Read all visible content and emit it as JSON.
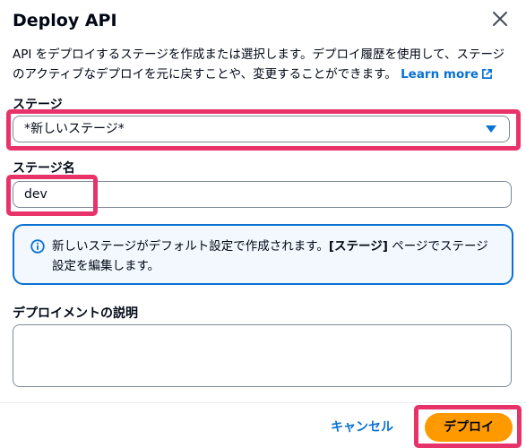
{
  "dialog": {
    "title": "Deploy API",
    "description": "API をデプロイするステージを作成または選択します。デプロイ履歴を使用して、ステージのアクティブなデプロイを元に戻すことや、変更することができます。",
    "learn_more": "Learn more"
  },
  "stage": {
    "label": "ステージ",
    "selected": "*新しいステージ*"
  },
  "stage_name": {
    "label": "ステージ名",
    "value": "dev"
  },
  "info": {
    "text_before": "新しいステージがデフォルト設定で作成されます。",
    "bold": "[ステージ]",
    "text_after": " ページでステージ設定を編集します。"
  },
  "deployment_description": {
    "label": "デプロイメントの説明",
    "value": ""
  },
  "footer": {
    "cancel": "キャンセル",
    "deploy": "デプロイ"
  },
  "colors": {
    "accent": "#0972d3",
    "primary_button": "#ff9900",
    "highlight": "#e8336a"
  },
  "icons": {
    "close": "close-icon",
    "external_link": "external-link-icon",
    "caret": "caret-down-icon",
    "info": "info-icon"
  }
}
